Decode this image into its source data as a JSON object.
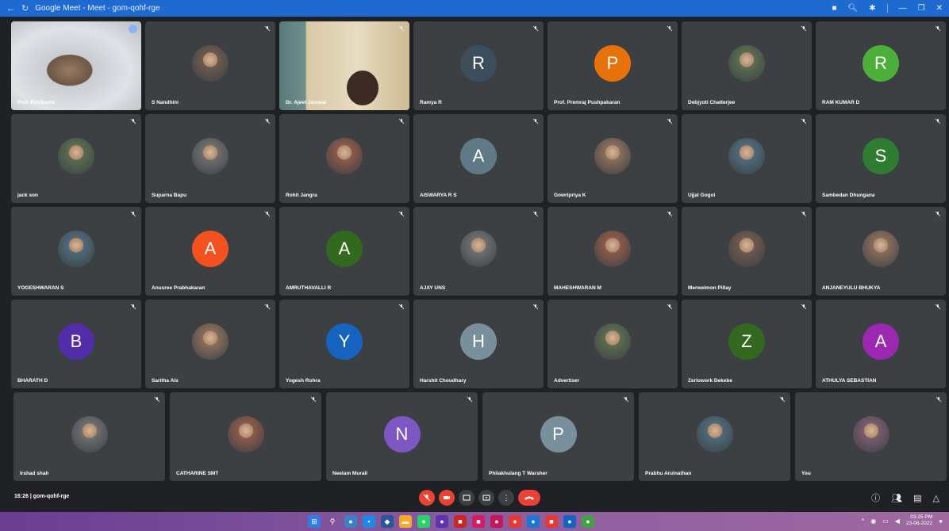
{
  "window": {
    "title": "Google Meet - Meet - gom-qohf-rge"
  },
  "participants_row1": [
    {
      "name": "Prof. Ravikanta",
      "kind": "video",
      "speaking": true
    },
    {
      "name": "S Nandhini",
      "kind": "photo"
    },
    {
      "name": "Dr. Ajeet Jaiswal",
      "kind": "video"
    },
    {
      "name": "Ramya R",
      "kind": "letter",
      "letter": "R",
      "color": "#3c4e5c"
    },
    {
      "name": "Prof. Premraj Pushpakaran",
      "kind": "letter",
      "letter": "P",
      "color": "#e8710a"
    },
    {
      "name": "Debjyoti Chatterjee",
      "kind": "photo"
    },
    {
      "name": "RAM KUMAR D",
      "kind": "letter",
      "letter": "R",
      "color": "#4caf3a"
    }
  ],
  "participants_row2": [
    {
      "name": "jack son",
      "kind": "photo"
    },
    {
      "name": "Suparna Bapu",
      "kind": "photo"
    },
    {
      "name": "Rohit Jangra",
      "kind": "photo"
    },
    {
      "name": "AISWARYA R S",
      "kind": "letter",
      "letter": "A",
      "color": "#5f7a86"
    },
    {
      "name": "Gowripriya K",
      "kind": "photo"
    },
    {
      "name": "Ujjal Gogoi",
      "kind": "photo"
    },
    {
      "name": "Sambedan Dhungana",
      "kind": "letter",
      "letter": "S",
      "color": "#2e7d32"
    }
  ],
  "participants_row3": [
    {
      "name": "YOGESHWARAN S",
      "kind": "photo"
    },
    {
      "name": "Anusree Prabhakaran",
      "kind": "letter",
      "letter": "A",
      "color": "#f4511e"
    },
    {
      "name": "AMRUTHAVALLI R",
      "kind": "letter",
      "letter": "A",
      "color": "#33691e"
    },
    {
      "name": "AJAY UNS",
      "kind": "photo"
    },
    {
      "name": "MAHESHWARAN M",
      "kind": "photo"
    },
    {
      "name": "Merwelmon Pillay",
      "kind": "photo"
    },
    {
      "name": "ANJANEYULU BHUKYA",
      "kind": "photo"
    }
  ],
  "participants_row4": [
    {
      "name": "BHARATH D",
      "kind": "letter",
      "letter": "B",
      "color": "#512da8"
    },
    {
      "name": "Saritha Als",
      "kind": "photo"
    },
    {
      "name": "Yogesh Rohra",
      "kind": "letter",
      "letter": "Y",
      "color": "#1565c0"
    },
    {
      "name": "Harshit Choudhary",
      "kind": "letter",
      "letter": "H",
      "color": "#78909c"
    },
    {
      "name": "Advertiser",
      "kind": "photo"
    },
    {
      "name": "Zerlowork Dekebe",
      "kind": "letter",
      "letter": "Z",
      "color": "#33691e"
    },
    {
      "name": "ATHULYA SEBASTIAN",
      "kind": "letter",
      "letter": "A",
      "color": "#9c27b0"
    }
  ],
  "participants_row5": [
    {
      "name": "Irshad shah",
      "kind": "photo"
    },
    {
      "name": "CATHARINE SMT",
      "kind": "photo"
    },
    {
      "name": "Neelam Murali",
      "kind": "letter",
      "letter": "N",
      "color": "#7e57c2"
    },
    {
      "name": "Philakhulang T Warsher",
      "kind": "letter",
      "letter": "P",
      "color": "#78909c"
    },
    {
      "name": "Prabhu Arulnathan",
      "kind": "photo"
    },
    {
      "name": "You",
      "kind": "photo"
    }
  ],
  "bottom": {
    "time": "16:26",
    "meeting_code": "gom-qohf-rge"
  },
  "taskbar": {
    "time": "03:25 PM",
    "date": "23-06-2022"
  }
}
